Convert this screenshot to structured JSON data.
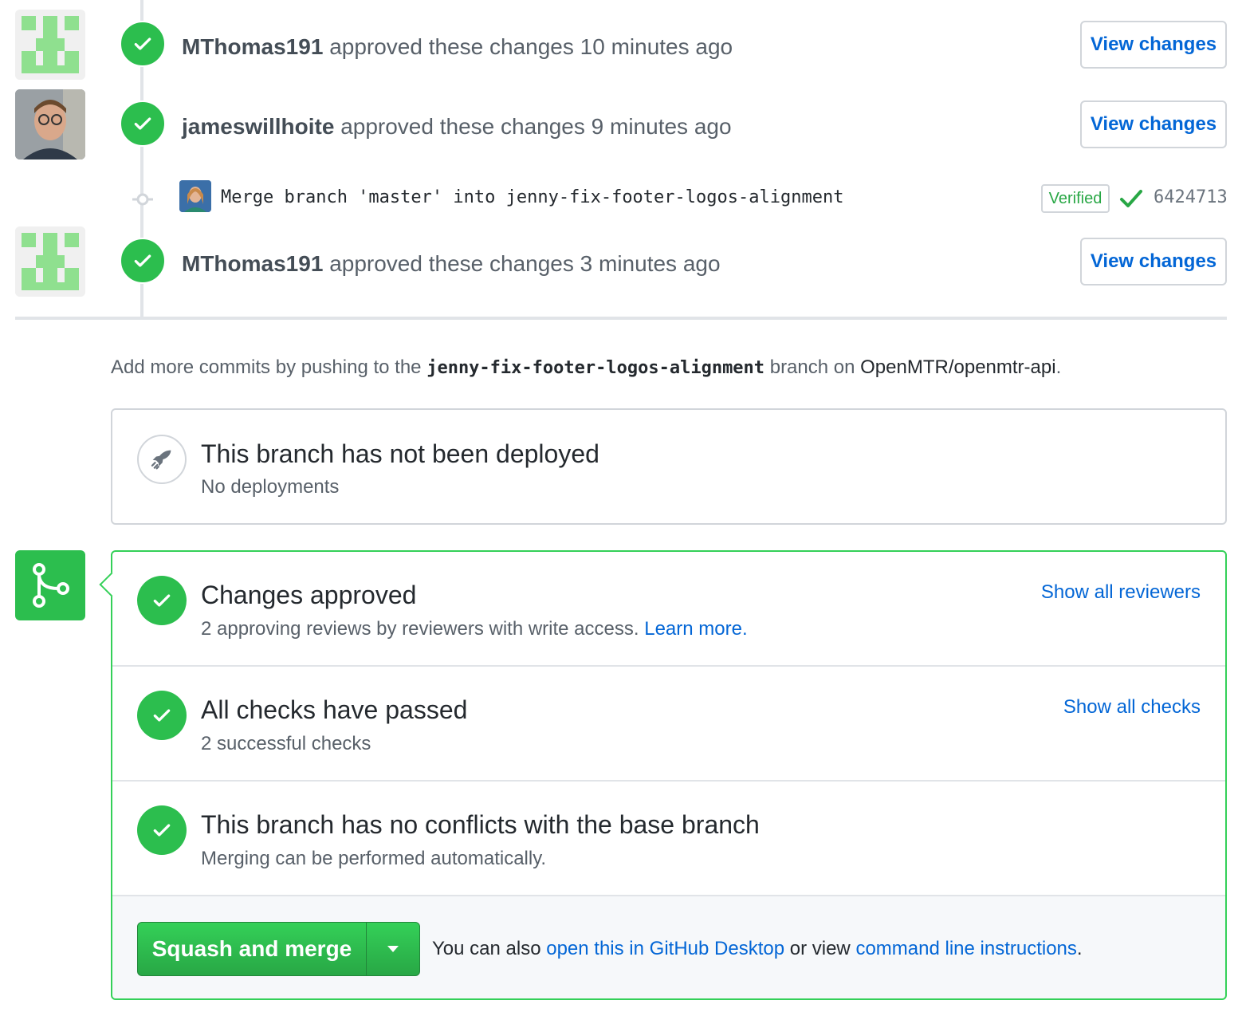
{
  "timeline": {
    "events": [
      {
        "author": "MThomas191",
        "action": "approved these changes",
        "time": "10 minutes ago",
        "button": "View changes"
      },
      {
        "author": "jameswillhoite",
        "action": "approved these changes",
        "time": "9 minutes ago",
        "button": "View changes"
      },
      {
        "author": "MThomas191",
        "action": "approved these changes",
        "time": "3 minutes ago",
        "button": "View changes"
      }
    ],
    "commit": {
      "message": "Merge branch 'master' into jenny-fix-footer-logos-alignment",
      "verified_label": "Verified",
      "sha": "6424713"
    }
  },
  "push_hint": {
    "prefix": "Add more commits by pushing to the",
    "branch": "jenny-fix-footer-logos-alignment",
    "middle": "branch on",
    "repo": "OpenMTR/openmtr-api",
    "suffix": "."
  },
  "deploy": {
    "title": "This branch has not been deployed",
    "subtitle": "No deployments"
  },
  "merge": {
    "sections": [
      {
        "title": "Changes approved",
        "subtitle": "2 approving reviews by reviewers with write access.",
        "subtitle_link": "Learn more.",
        "link": "Show all reviewers"
      },
      {
        "title": "All checks have passed",
        "subtitle": "2 successful checks",
        "link": "Show all checks"
      },
      {
        "title": "This branch has no conflicts with the base branch",
        "subtitle": "Merging can be performed automatically."
      }
    ],
    "button_label": "Squash and merge",
    "footer": {
      "prefix": "You can also",
      "desktop_link": "open this in GitHub Desktop",
      "middle": "or view",
      "cli_link": "command line instructions",
      "suffix": "."
    }
  },
  "colors": {
    "success": "#2cbe4e",
    "link": "#0366d6",
    "border_success": "#34d058"
  }
}
